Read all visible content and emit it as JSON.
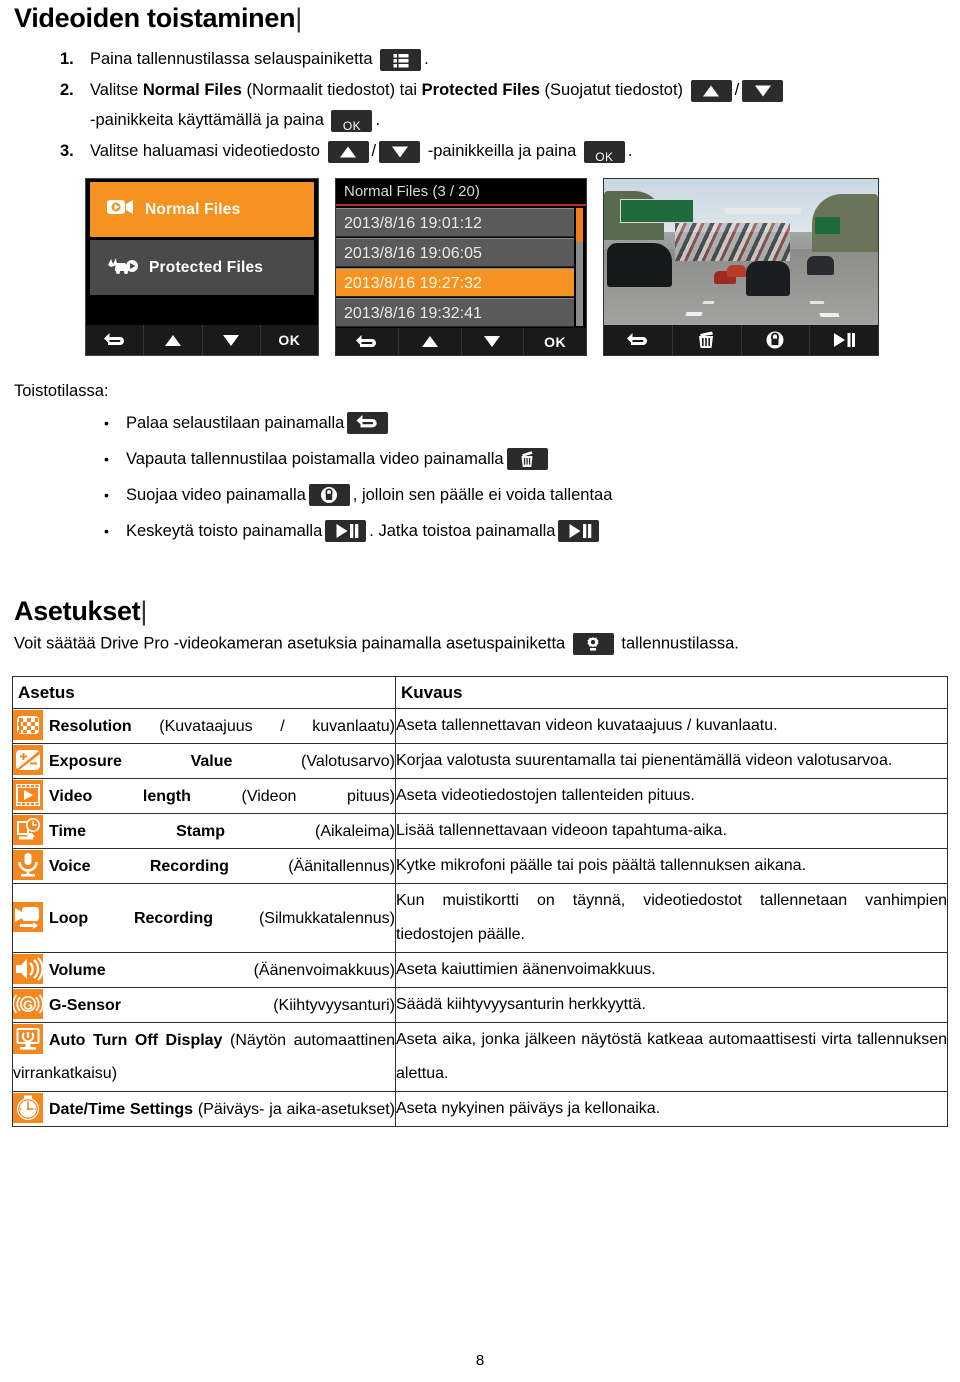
{
  "headings": {
    "playback": "Videoiden toistaminen",
    "settings": "Asetukset",
    "bar": "|"
  },
  "steps": [
    {
      "num": "1.",
      "pre": "Paina tallennustilassa selauspainiketta",
      "post": ".",
      "icons": [
        "list-icon"
      ]
    },
    {
      "num": "2.",
      "pre": "Valitse ",
      "bold1": "Normal Files",
      "mid1": " (Normaalit tiedostot) tai ",
      "bold2": "Protected Files",
      "mid2": " (Suojatut tiedostot)",
      "sep": "/",
      "line2_pre": "-painikkeita käyttämällä ja paina",
      "line2_post": ".",
      "icons": [
        "arrow-up-icon",
        "arrow-down-icon",
        "ok-icon"
      ]
    },
    {
      "num": "3.",
      "pre": "Valitse haluamasi videotiedosto",
      "sep": "/",
      "mid": "-painikkeilla ja paina",
      "post": ".",
      "icons": [
        "arrow-up-icon",
        "arrow-down-icon",
        "ok-icon"
      ]
    }
  ],
  "step_labels": {
    "ok": "OK"
  },
  "screenshots": {
    "menu": {
      "items": [
        {
          "label": "Normal Files",
          "selected": true,
          "icon": "video-camera-icon"
        },
        {
          "label": "Protected Files",
          "selected": false,
          "icon": "car-crash-icon"
        }
      ],
      "navbar": [
        "back-icon",
        "arrow-up-icon",
        "arrow-down-icon",
        "OK"
      ],
      "nav_ok_label": "OK"
    },
    "filelist": {
      "title": "Normal Files (3 / 20)",
      "rows": [
        {
          "text": "2013/8/16 19:01:12",
          "highlighted": false
        },
        {
          "text": "2013/8/16 19:06:05",
          "highlighted": false
        },
        {
          "text": "2013/8/16 19:27:32",
          "highlighted": true
        },
        {
          "text": "2013/8/16 19:32:41",
          "highlighted": false
        }
      ],
      "navbar": [
        "back-icon",
        "arrow-up-icon",
        "arrow-down-icon",
        "OK"
      ],
      "nav_ok_label": "OK"
    },
    "video": {
      "navbar": [
        "back-icon",
        "trash-icon",
        "lock-icon",
        "play-pause-icon"
      ]
    }
  },
  "playback_mode": {
    "label": "Toistotilassa:",
    "bullets": [
      {
        "dot": "•",
        "pre": "Palaa selaustilaan painamalla",
        "post": "",
        "icons": [
          "back-icon"
        ]
      },
      {
        "dot": "•",
        "pre": "Vapauta tallennustilaa poistamalla video painamalla",
        "post": "",
        "icons": [
          "trash-icon"
        ]
      },
      {
        "dot": "•",
        "pre": "Suojaa video painamalla",
        "post": ", jolloin sen päälle ei voida tallentaa",
        "icons": [
          "lock-icon"
        ]
      },
      {
        "dot": "•",
        "pre": "Keskeytä toisto painamalla",
        "mid": ". Jatka toistoa painamalla",
        "post": "",
        "icons": [
          "play-pause-icon",
          "play-pause-icon"
        ]
      }
    ]
  },
  "settings_intro": {
    "pre": "Voit säätää Drive Pro -videokameran asetuksia painamalla asetuspainiketta",
    "post": "tallennustilassa.",
    "icon": "gear-icon"
  },
  "settings_table": {
    "headers": [
      "Asetus",
      "Kuvaus"
    ],
    "rows": [
      {
        "icon": "resolution-icon",
        "name": "Resolution",
        "translation": "(Kuvataajuus / kuvanlaatu)",
        "description": "Aseta tallennettavan videon kuvataajuus / kuvanlaatu.",
        "justify": false
      },
      {
        "icon": "exposure-icon",
        "name": "Exposure Value",
        "translation": "(Valotusarvo)",
        "description": "Korjaa valotusta suurentamalla tai pienentämällä videon valotusarvoa.",
        "justify": true
      },
      {
        "icon": "video-length-icon",
        "name": "Video length",
        "translation": "(Videon pituus)",
        "description": "Aseta videotiedostojen tallenteiden pituus.",
        "justify": false
      },
      {
        "icon": "time-stamp-icon",
        "name": "Time Stamp",
        "translation": "(Aikaleima)",
        "description": "Lisää tallennettavaan videoon tapahtuma-aika.",
        "justify": false
      },
      {
        "icon": "microphone-icon",
        "name": "Voice Recording",
        "translation": "(Äänitallennus)",
        "description": "Kytke mikrofoni päälle tai pois päältä tallennuksen aikana.",
        "justify": false
      },
      {
        "icon": "loop-recording-icon",
        "name": "Loop Recording",
        "translation": "(Silmukkatalennus)",
        "description": "Kun muistikortti on täynnä, videotiedostot tallennetaan vanhimpien tiedostojen päälle.",
        "justify": true
      },
      {
        "icon": "speaker-icon",
        "name": "Volume",
        "translation": "(Äänenvoimakkuus)",
        "description": "Aseta kaiuttimien äänenvoimakkuus.",
        "justify": false
      },
      {
        "icon": "g-sensor-icon",
        "name": "G-Sensor",
        "translation": "(Kiihtyvyysanturi)",
        "description": "Säädä kiihtyvyysanturin herkkyyttä.",
        "justify": false
      },
      {
        "icon": "display-power-icon",
        "name": "Auto Turn Off Display",
        "translation": "(Näytön automaattinen virrankatkaisu)",
        "description": "Aseta aika, jonka jälkeen näytöstä katkeaa automaattisesti virta tallennuksen alettua.",
        "justify": true
      },
      {
        "icon": "clock-icon",
        "name": "Date/Time Settings",
        "translation": "(Päiväys- ja aika-asetukset)",
        "description": "Aseta nykyinen päiväys ja kellonaika.",
        "justify": false
      }
    ]
  },
  "page_number": "8",
  "colors": {
    "accent_orange": "#f5871f",
    "device_dark": "#2b2b2b",
    "list_row": "#5a5a5a"
  }
}
